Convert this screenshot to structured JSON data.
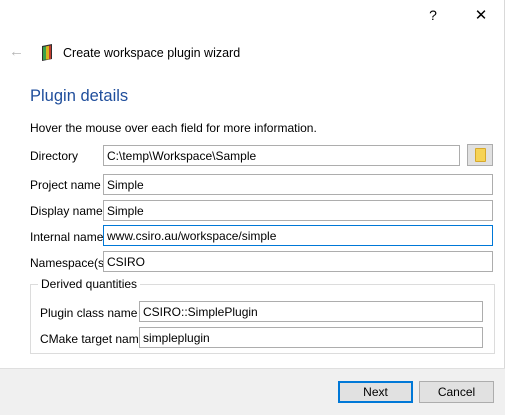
{
  "titlebar": {
    "help_glyph": "?",
    "close_glyph": "✕"
  },
  "header": {
    "back_glyph": "←",
    "icon": "workspace-app-icon",
    "title": "Create workspace plugin wizard"
  },
  "page": {
    "heading": "Plugin details",
    "hint": "Hover the mouse over each field for more information."
  },
  "fields": {
    "directory": {
      "label": "Directory",
      "value": "C:\\temp\\Workspace\\Sample"
    },
    "project_name": {
      "label": "Project name",
      "value": "Simple"
    },
    "display_name": {
      "label": "Display name",
      "value": "Simple"
    },
    "internal_name": {
      "label": "Internal name",
      "value": "www.csiro.au/workspace/simple"
    },
    "namespace": {
      "label": "Namespace(s)",
      "value": "CSIRO"
    }
  },
  "derived": {
    "title": "Derived quantities",
    "plugin_class": {
      "label": "Plugin class name",
      "value": "CSIRO::SimplePlugin"
    },
    "cmake_target": {
      "label": "CMake target name",
      "value": "simpleplugin"
    }
  },
  "buttons": {
    "next": "Next",
    "cancel": "Cancel",
    "browse_icon": "folder-icon"
  },
  "colors": {
    "heading": "#1f4e9c",
    "focus": "#0078d7",
    "footer": "#f0f0f0"
  }
}
